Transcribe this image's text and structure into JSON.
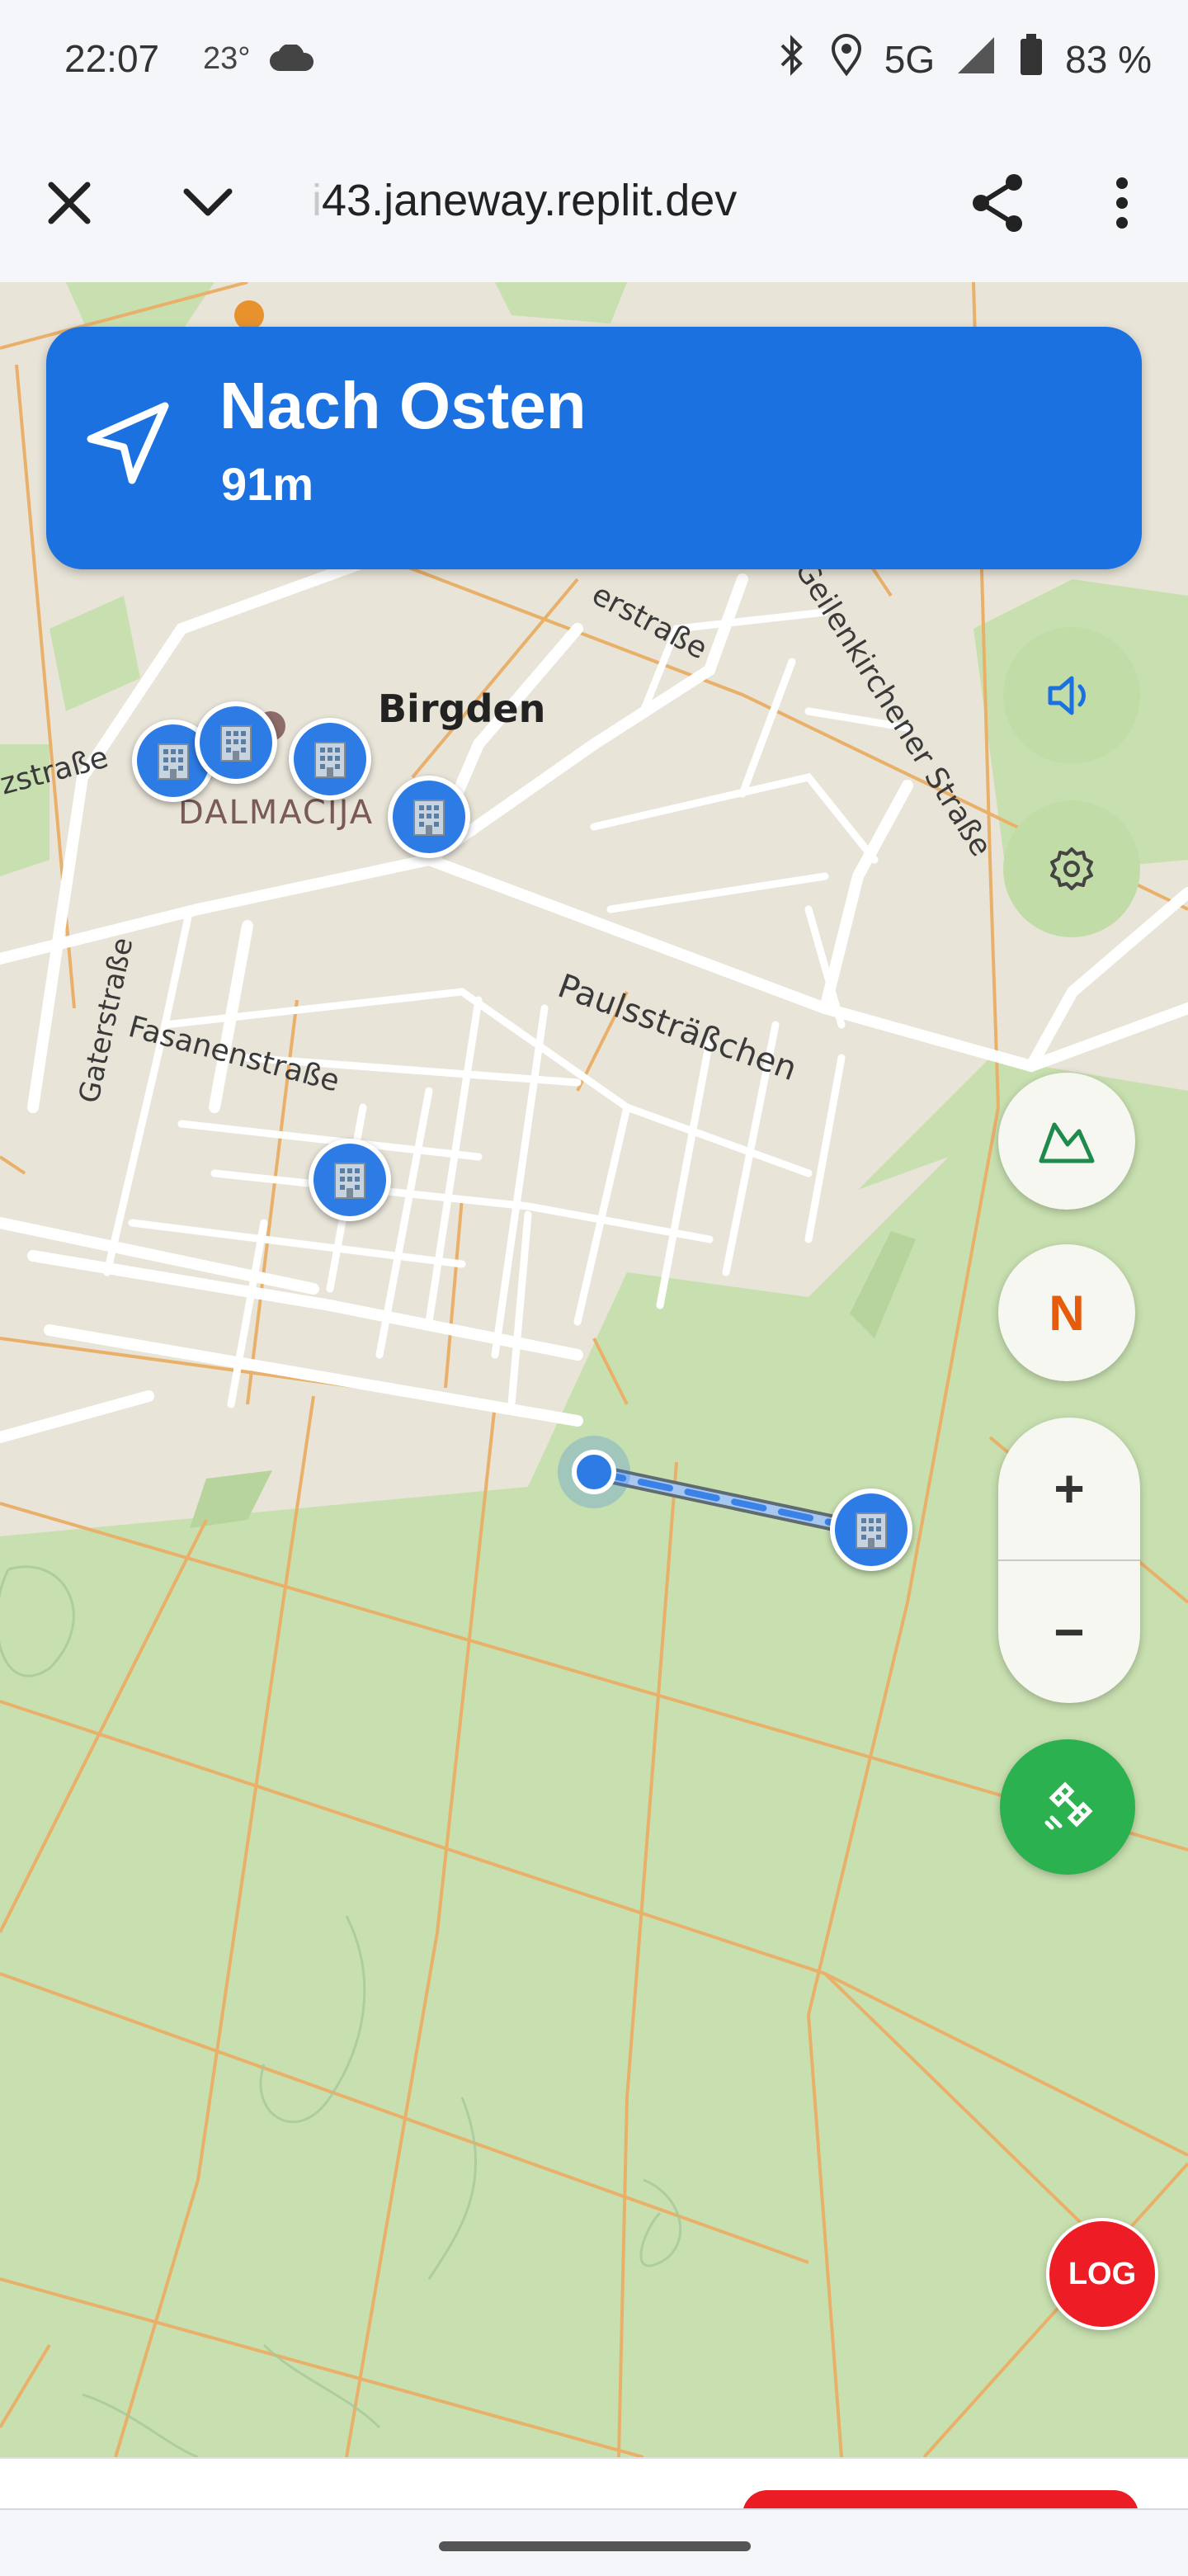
{
  "status_bar": {
    "time": "22:07",
    "temperature": "23°",
    "network": "5G",
    "battery": "83 %"
  },
  "browser": {
    "url_fade": "i",
    "url": "i43.janeway.replit.dev",
    "url_visible": "43.janeway.replit.dev"
  },
  "navigation": {
    "instruction": "Nach Osten",
    "distance": "91m"
  },
  "map": {
    "labels": {
      "town": "Birgden",
      "district": "DALMACIJA",
      "street_1": "Paulssträßchen",
      "street_2": "Fasanenstraße",
      "street_3": "Gaterstraße",
      "street_4": "Geilenkirchener Straße",
      "street_5": "zstraße",
      "street_6": "erstraße"
    }
  },
  "controls": {
    "zoom_in": "+",
    "zoom_out": "−",
    "compass": "N",
    "log": "LOG"
  },
  "colors": {
    "nav_banner": "#1c71e0",
    "route": "#2d7be5",
    "gps_button": "#2bb14f",
    "log_button": "#ee1c24"
  }
}
